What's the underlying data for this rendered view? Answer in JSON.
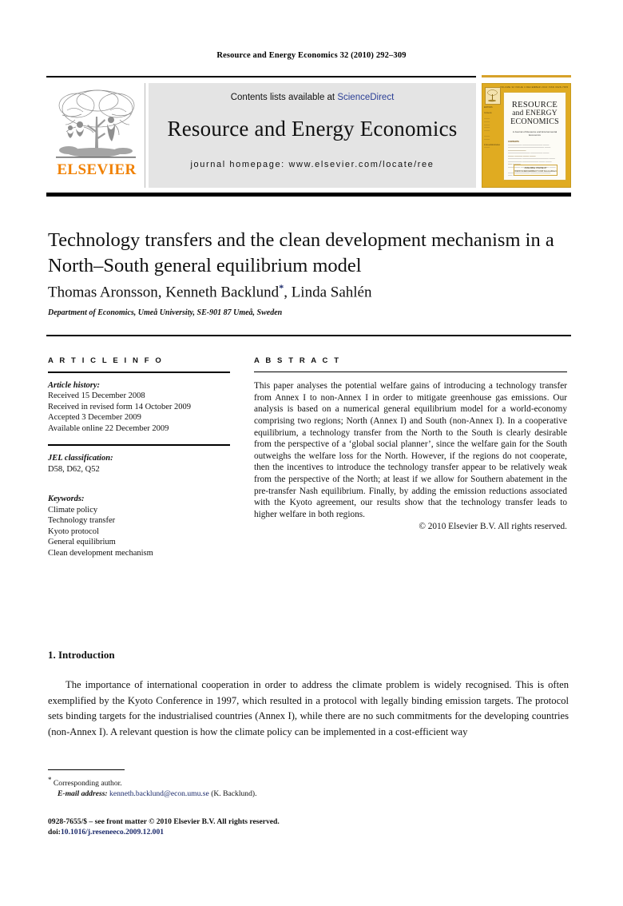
{
  "running_head": "Resource and Energy Economics 32 (2010) 292–309",
  "masthead": {
    "contents_prefix": "Contents lists available at ",
    "sciencedirect": "ScienceDirect",
    "journal_name": "Resource and Energy Economics",
    "homepage": "journal homepage: www.elsevier.com/locate/ree",
    "publisher_wordmark": "ELSEVIER",
    "sciencedirect_color": "#2b3f96",
    "elsevier_orange": "#f08000"
  },
  "cover": {
    "topline": "VOLUME 32   ISSUE 4   DECEMBER 2010        ISSN 0928-7655",
    "title_line1": "RESOURCE",
    "title_line2": "and ENERGY",
    "title_line3": "ECONOMICS",
    "subtitle": "A Journal of Resource and Environmental Economics",
    "toc_heading": "CONTENTS",
    "footer": "AVAILABLE ONLINE AT\nWWW.SCIENCEDIRECT.COM\nScienceDirect",
    "background_color": "#e0ab21"
  },
  "article": {
    "title": "Technology transfers and the clean development mechanism in a North–South general equilibrium model",
    "authors_before_mark": "Thomas Aronsson, Kenneth Backlund",
    "corresponding_mark": "*",
    "authors_after_mark": ", Linda Sahlén",
    "affiliation": "Department of Economics, Umeå University, SE-901 87 Umeå, Sweden"
  },
  "article_info": {
    "heading": "A R T I C L E   I N F O",
    "history_label": "Article history:",
    "history": [
      "Received 15 December 2008",
      "Received in revised form 14 October 2009",
      "Accepted 3 December 2009",
      "Available online 22 December 2009"
    ],
    "jel_label": "JEL classification:",
    "jel_codes": "D58, D62, Q52",
    "keywords_label": "Keywords:",
    "keywords": [
      "Climate policy",
      "Technology transfer",
      "Kyoto protocol",
      "General equilibrium",
      "Clean development mechanism"
    ]
  },
  "abstract": {
    "heading": "A B S T R A C T",
    "text": "This paper analyses the potential welfare gains of introducing a technology transfer from Annex I to non-Annex I in order to mitigate greenhouse gas emissions. Our analysis is based on a numerical general equilibrium model for a world-economy comprising two regions; North (Annex I) and South (non-Annex I). In a cooperative equilibrium, a technology transfer from the North to the South is clearly desirable from the perspective of a ‘global social planner’, since the welfare gain for the South outweighs the welfare loss for the North. However, if the regions do not cooperate, then the incentives to introduce the technology transfer appear to be relatively weak from the perspective of the North; at least if we allow for Southern abatement in the pre-transfer Nash equilibrium. Finally, by adding the emission reductions associated with the Kyoto agreement, our results show that the technology transfer leads to higher welfare in both regions.",
    "copyright": "© 2010 Elsevier B.V. All rights reserved."
  },
  "body": {
    "section_heading": "1.  Introduction",
    "paragraph": "The importance of international cooperation in order to address the climate problem is widely recognised. This is often exemplified by the Kyoto Conference in 1997, which resulted in a protocol with legally binding emission targets. The protocol sets binding targets for the industrialised countries (Annex I), while there are no such commitments for the developing countries (non-Annex I). A relevant question is how the climate policy can be implemented in a cost-efficient way"
  },
  "footnotes": {
    "corresponding_author": "Corresponding author.",
    "email_label": "E-mail address:",
    "email": "kenneth.backlund@econ.umu.se",
    "email_owner": "(K. Backlund).",
    "issn_line": "0928-7655/$ – see front matter © 2010 Elsevier B.V. All rights reserved.",
    "doi_label": "doi:",
    "doi": "10.1016/j.reseneeco.2009.12.001"
  }
}
